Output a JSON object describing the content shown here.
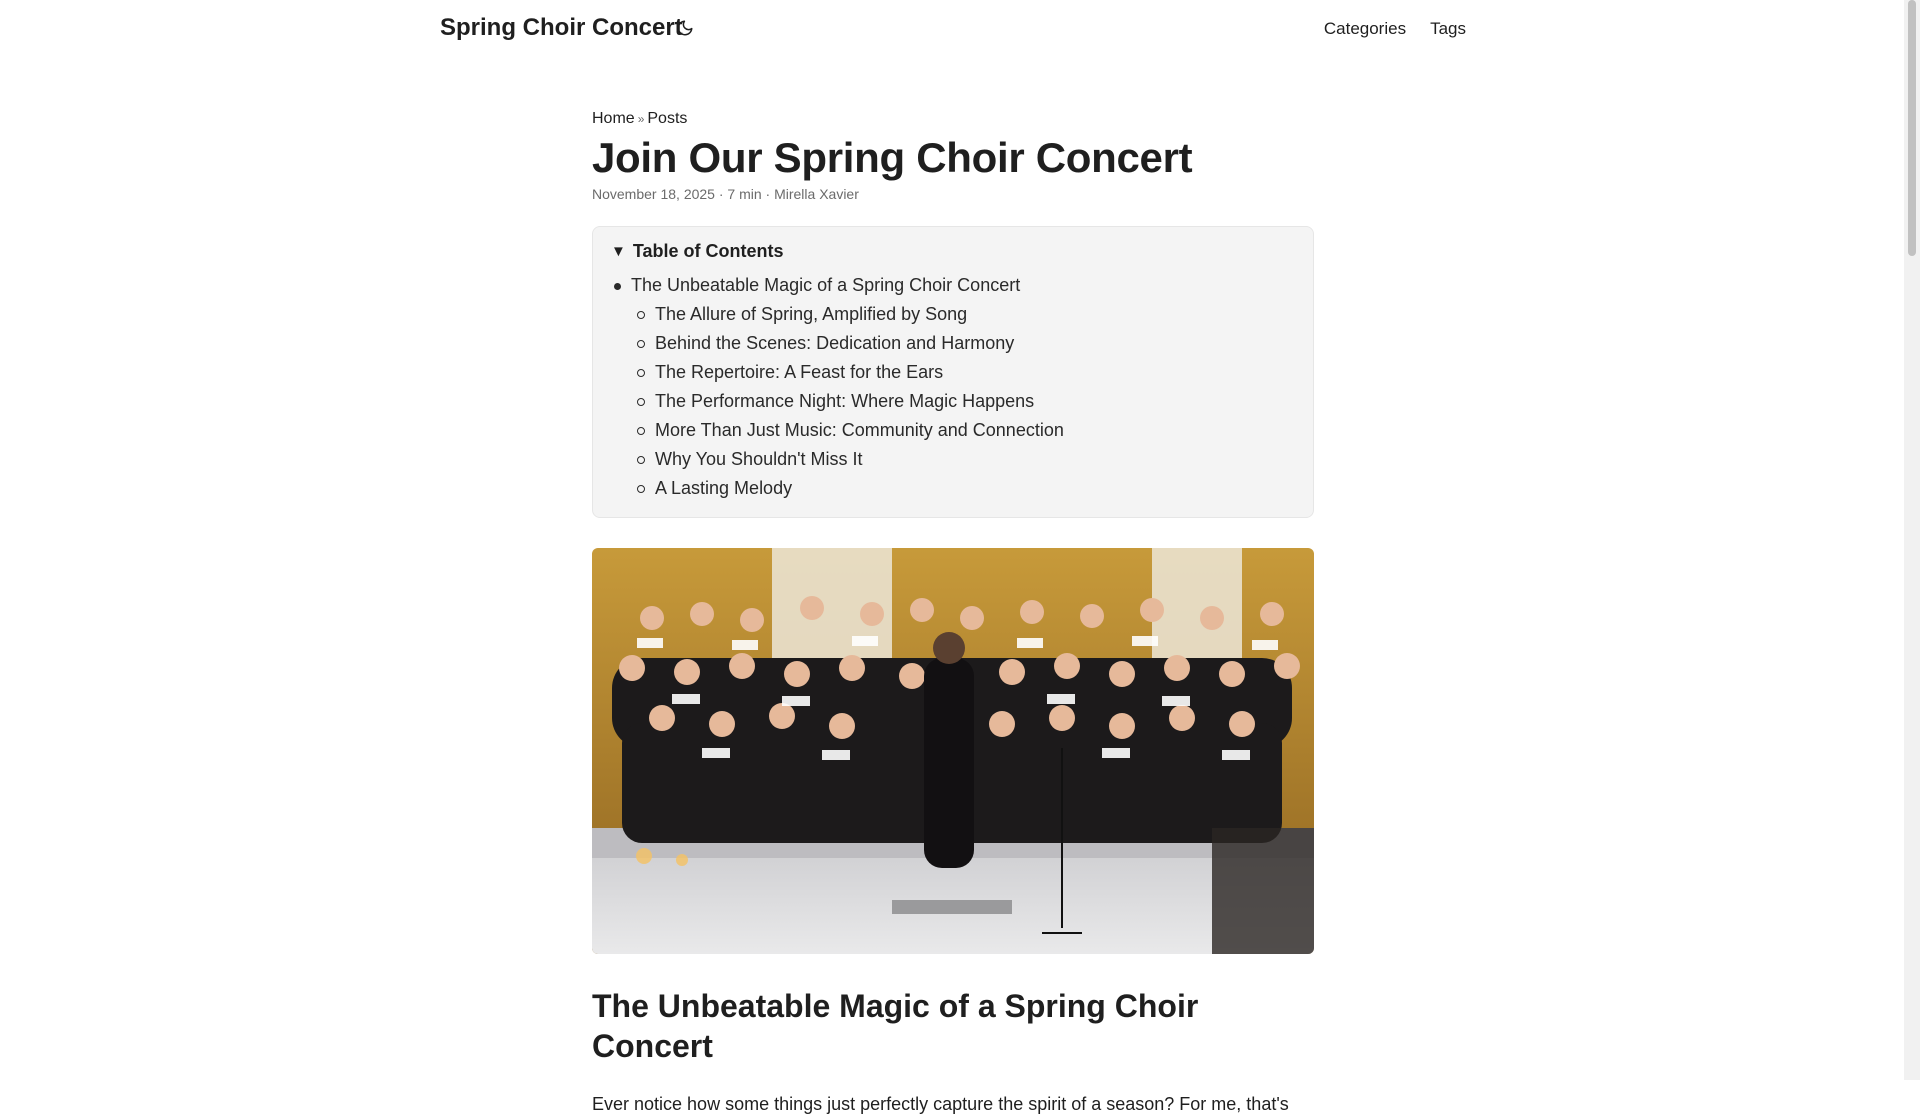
{
  "header": {
    "site_title": "Spring Choir Concert",
    "theme_icon": "moon-icon",
    "menu": [
      {
        "label": "Categories"
      },
      {
        "label": "Tags"
      }
    ]
  },
  "breadcrumbs": {
    "home": "Home",
    "separator": "»",
    "posts": "Posts"
  },
  "post": {
    "title": "Join Our Spring Choir Concert",
    "meta": "November 18, 2025 · 7 min · Mirella Xavier"
  },
  "toc": {
    "summary": "Table of Contents",
    "items": [
      {
        "label": "The Unbeatable Magic of a Spring Choir Concert"
      }
    ],
    "subitems": [
      {
        "label": "The Allure of Spring, Amplified by Song"
      },
      {
        "label": "Behind the Scenes: Dedication and Harmony"
      },
      {
        "label": "The Repertoire: A Feast for the Ears"
      },
      {
        "label": "The Performance Night: Where Magic Happens"
      },
      {
        "label": "More Than Just Music: Community and Connection"
      },
      {
        "label": "Why You Shouldn't Miss It"
      },
      {
        "label": "A Lasting Melody"
      }
    ]
  },
  "content": {
    "section_heading": "The Unbeatable Magic of a Spring Choir Concert",
    "intro": "Ever notice how some things just perfectly capture the spirit of a season? For me, that's"
  },
  "colors": {
    "text": "#1f1f1f",
    "muted": "#6b6b6b",
    "toc_bg": "#f4f4f4",
    "stage_wall": "#b8862a"
  }
}
